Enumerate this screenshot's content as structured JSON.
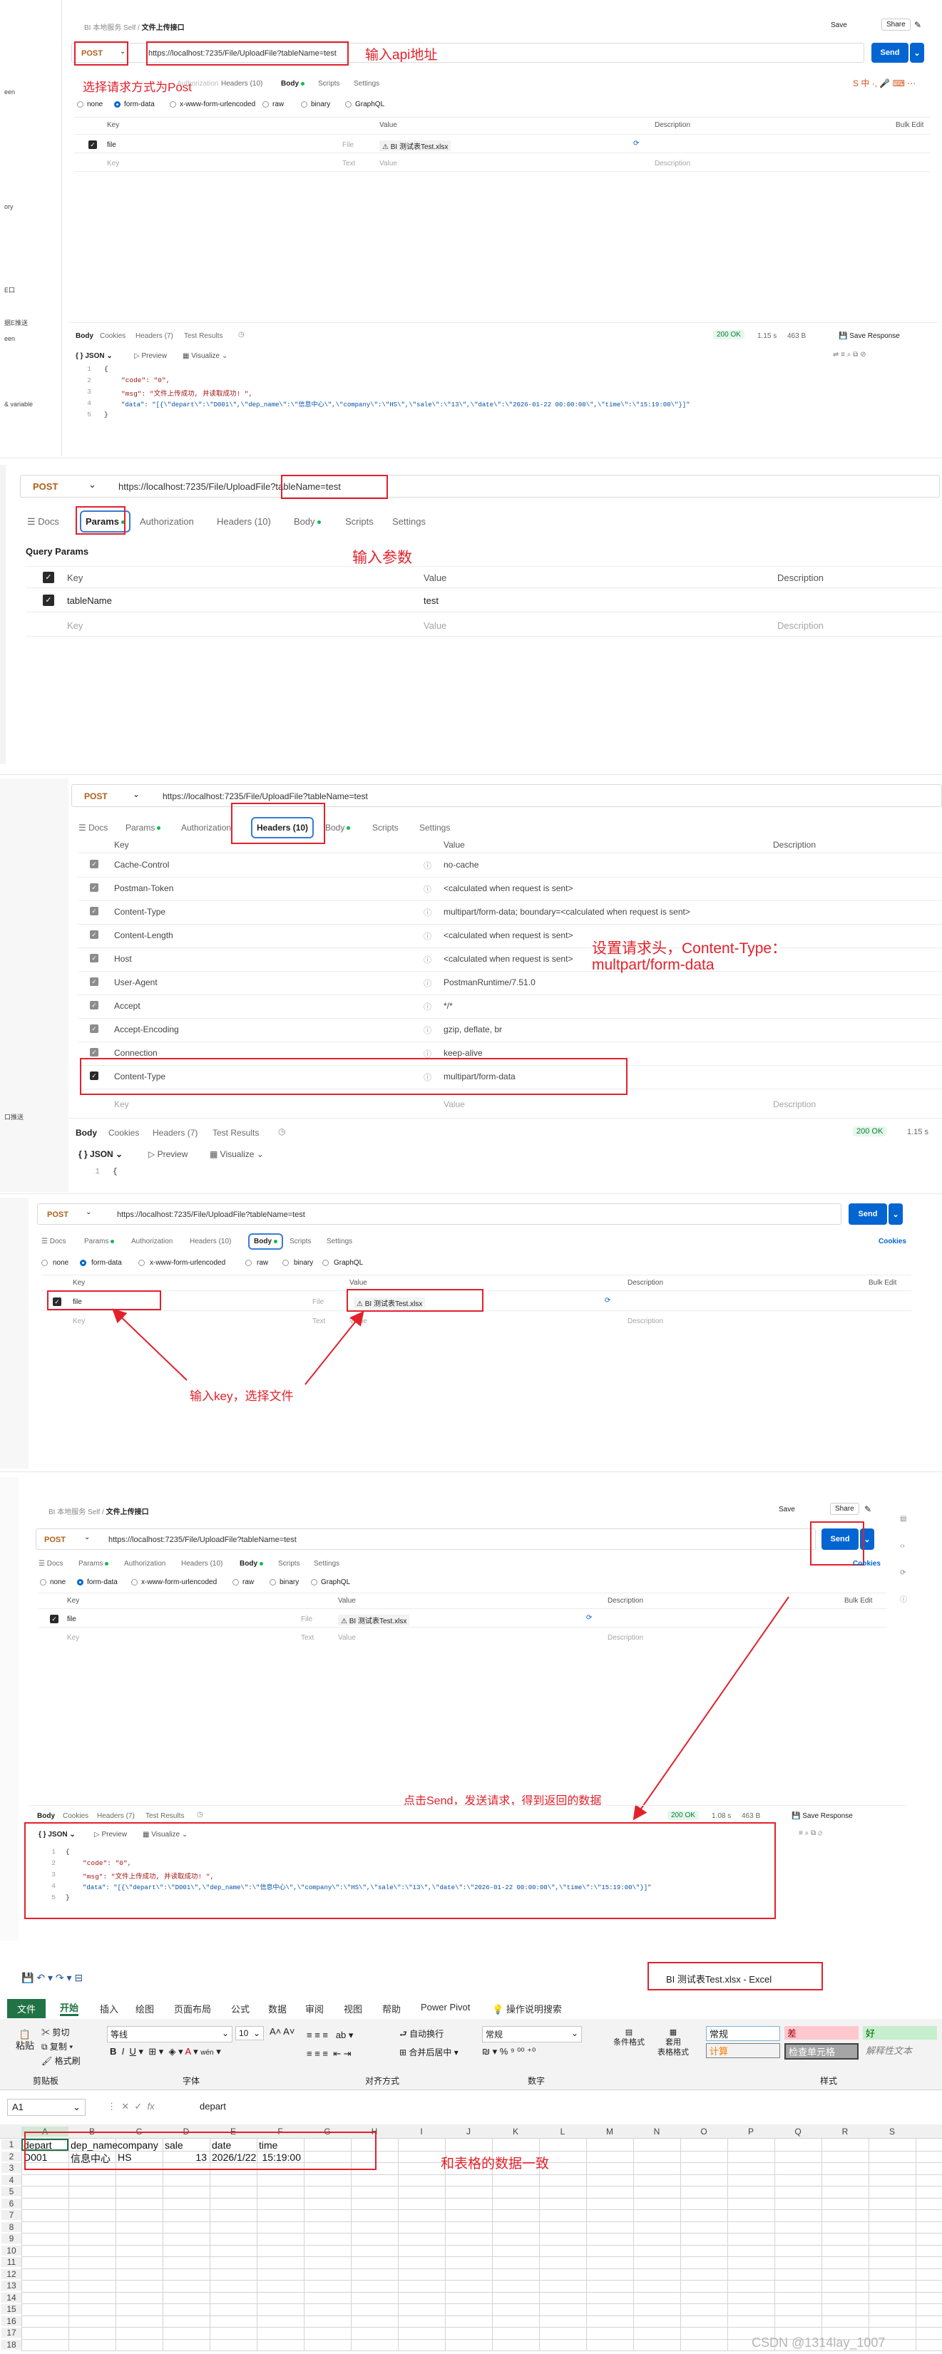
{
  "panel1": {
    "breadcrumb": "BI 本地服务 Self",
    "request_name": "文件上传接口",
    "save": "Save",
    "share": "Share",
    "method": "POST",
    "url": "https://localhost:7235/File/UploadFile?tableName=test",
    "send": "Send",
    "tabs": [
      "Docs",
      "Params",
      "Authorization",
      "Headers (10)",
      "Body",
      "Scripts",
      "Settings"
    ],
    "body_modes": [
      "none",
      "form-data",
      "x-www-form-urlencoded",
      "raw",
      "binary",
      "GraphQL"
    ],
    "cols": [
      "Key",
      "Value",
      "Description"
    ],
    "bulk_edit": "Bulk Edit",
    "row_key": "file",
    "row_type": "File",
    "row_value": "BI 测试表Test.xlsx",
    "placeholder_key": "Key",
    "placeholder_type": "Text",
    "placeholder_value": "Value",
    "placeholder_desc": "Description",
    "resp_tabs": [
      "Body",
      "Cookies",
      "Headers (7)",
      "Test Results"
    ],
    "status": "200 OK",
    "time": "1.15 s",
    "size": "463 B",
    "save_response": "Save Response",
    "format": "JSON",
    "preview": "Preview",
    "visualize": "Visualize",
    "code_lines": [
      "{",
      "\"code\": \"0\",",
      "\"msg\": \"文件上传成功, 并读取成功! \",",
      "\"data\": \"[{\\\"depart\\\":\\\"D001\\\",\\\"dep_name\\\":\\\"信息中心\\\",\\\"company\\\":\\\"HS\\\",\\\"sale\\\":\\\"13\\\",\\\"date\\\":\\\"2026-01-22 00:00:00\\\",\\\"time\\\":\\\"15:19:00\\\"}]\"",
      "}"
    ],
    "note_method": "选择请求方式为Post",
    "note_url": "输入api地址",
    "left_stubs": [
      "een",
      "ory",
      "E口",
      "据E推送",
      "een",
      "& variable"
    ]
  },
  "panel2": {
    "method": "POST",
    "url_pre": "https://localhost:7235/File/UploadFile",
    "url_query": "?tableName=test",
    "tabs": [
      "Docs",
      "Params",
      "Authorization",
      "Headers (10)",
      "Body",
      "Scripts",
      "Settings"
    ],
    "section": "Query Params",
    "cols": [
      "Key",
      "Value",
      "Description"
    ],
    "row_key": "tableName",
    "row_value": "test",
    "placeholder_key": "Key",
    "placeholder_value": "Value",
    "placeholder_desc": "Description",
    "note": "输入参数"
  },
  "panel3": {
    "method": "POST",
    "url": "https://localhost:7235/File/UploadFile?tableName=test",
    "tabs": [
      "Docs",
      "Params",
      "Authorization",
      "Headers (10)",
      "Body",
      "Scripts",
      "Settings"
    ],
    "cols": [
      "Key",
      "Value",
      "Description"
    ],
    "headers": [
      {
        "key": "Cache-Control",
        "value": "no-cache"
      },
      {
        "key": "Postman-Token",
        "value": "<calculated when request is sent>"
      },
      {
        "key": "Content-Type",
        "value": "multipart/form-data; boundary=<calculated when request is sent>"
      },
      {
        "key": "Content-Length",
        "value": "<calculated when request is sent>"
      },
      {
        "key": "Host",
        "value": "<calculated when request is sent>"
      },
      {
        "key": "User-Agent",
        "value": "PostmanRuntime/7.51.0"
      },
      {
        "key": "Accept",
        "value": "*/*"
      },
      {
        "key": "Accept-Encoding",
        "value": "gzip, deflate, br"
      },
      {
        "key": "Connection",
        "value": "keep-alive"
      },
      {
        "key": "Content-Type",
        "value": "multipart/form-data"
      }
    ],
    "placeholder_key": "Key",
    "placeholder_value": "Value",
    "placeholder_desc": "Description",
    "resp_tabs": [
      "Body",
      "Cookies",
      "Headers (7)",
      "Test Results"
    ],
    "status": "200 OK",
    "time": "1.15 s",
    "format": "JSON",
    "preview": "Preview",
    "visualize": "Visualize",
    "note_line1": "设置请求头，Content-Type：",
    "note_line2": "multpart/form-data",
    "left_stub": "口推送"
  },
  "panel4": {
    "method": "POST",
    "url": "https://localhost:7235/File/UploadFile?tableName=test",
    "send": "Send",
    "cookies": "Cookies",
    "tabs": [
      "Docs",
      "Params",
      "Authorization",
      "Headers (10)",
      "Body",
      "Scripts",
      "Settings"
    ],
    "body_modes": [
      "none",
      "form-data",
      "x-www-form-urlencoded",
      "raw",
      "binary",
      "GraphQL"
    ],
    "cols": [
      "Key",
      "Value",
      "Description"
    ],
    "bulk_edit": "Bulk Edit",
    "row_key": "file",
    "row_type": "File",
    "row_value": "BI 测试表Test.xlsx",
    "placeholder_key": "Key",
    "placeholder_type": "Text",
    "placeholder_value": "Value",
    "placeholder_desc": "Description",
    "note": "输入key，选择文件"
  },
  "panel5": {
    "breadcrumb": "BI 本地服务 Self",
    "request_name": "文件上传接口",
    "save": "Save",
    "share": "Share",
    "method": "POST",
    "url": "https://localhost:7235/File/UploadFile?tableName=test",
    "send": "Send",
    "cookies": "Cookies",
    "tabs": [
      "Docs",
      "Params",
      "Authorization",
      "Headers (10)",
      "Body",
      "Scripts",
      "Settings"
    ],
    "body_modes": [
      "none",
      "form-data",
      "x-www-form-urlencoded",
      "raw",
      "binary",
      "GraphQL"
    ],
    "cols": [
      "Key",
      "Value",
      "Description"
    ],
    "bulk_edit": "Bulk Edit",
    "row_key": "file",
    "row_type": "File",
    "row_value": "BI 测试表Test.xlsx",
    "placeholder_key": "Key",
    "placeholder_type": "Text",
    "placeholder_value": "Value",
    "placeholder_desc": "Description",
    "resp_tabs": [
      "Body",
      "Cookies",
      "Headers (7)",
      "Test Results"
    ],
    "status": "200 OK",
    "time": "1.08 s",
    "size": "463 B",
    "save_response": "Save Response",
    "format": "JSON",
    "preview": "Preview",
    "visualize": "Visualize",
    "code_lines": [
      "{",
      "\"code\": \"0\",",
      "\"msg\": \"文件上传成功, 并读取成功! \",",
      "\"data\": \"[{\\\"depart\\\":\\\"D001\\\",\\\"dep_name\\\":\\\"信息中心\\\",\\\"company\\\":\\\"HS\\\",\\\"sale\\\":\\\"13\\\",\\\"date\\\":\\\"2026-01-22 00:00:00\\\",\\\"time\\\":\\\"15:19:00\\\"}]\"",
      "}"
    ],
    "note": "点击Send，发送请求，得到返回的数据"
  },
  "panel6": {
    "title": "BI 测试表Test.xlsx  -  Excel",
    "tabs": [
      "文件",
      "开始",
      "插入",
      "绘图",
      "页面布局",
      "公式",
      "数据",
      "审阅",
      "视图",
      "帮助",
      "Power Pivot",
      "操作说明搜索"
    ],
    "clipboard": {
      "paste": "粘贴",
      "cut": "剪切",
      "copy": "复制",
      "format": "格式刷",
      "label": "剪贴板"
    },
    "font": {
      "name": "等线",
      "size": "10",
      "label": "字体"
    },
    "align": {
      "wrap": "自动换行",
      "merge": "合并后居中",
      "label": "对齐方式"
    },
    "number": {
      "format": "常规",
      "label": "数字"
    },
    "styles": {
      "cond": "条件格式",
      "table": "套用\n表格格式",
      "normal": "常规",
      "bad": "差",
      "good": "好",
      "calc": "计算",
      "check": "检查单元格",
      "explain": "解释性文本",
      "label": "样式"
    },
    "name_box": "A1",
    "formula": "depart",
    "columns": [
      "A",
      "B",
      "C",
      "D",
      "E",
      "F",
      "G",
      "H",
      "I",
      "J",
      "K",
      "L",
      "M",
      "N",
      "O",
      "P",
      "Q",
      "R",
      "S"
    ],
    "rows": [
      "1",
      "2",
      "3",
      "4",
      "5",
      "6",
      "7",
      "8",
      "9",
      "10",
      "11",
      "12",
      "13",
      "14",
      "15",
      "16",
      "17",
      "18"
    ],
    "headers_row": [
      "depart",
      "dep_name",
      "company",
      "sale",
      "date",
      "time"
    ],
    "data_row": [
      "D001",
      "信息中心",
      "HS",
      "13",
      "2026/1/22",
      "15:19:00"
    ],
    "note": "和表格的数据一致",
    "footer": "CSDN @1314lay_1007"
  }
}
